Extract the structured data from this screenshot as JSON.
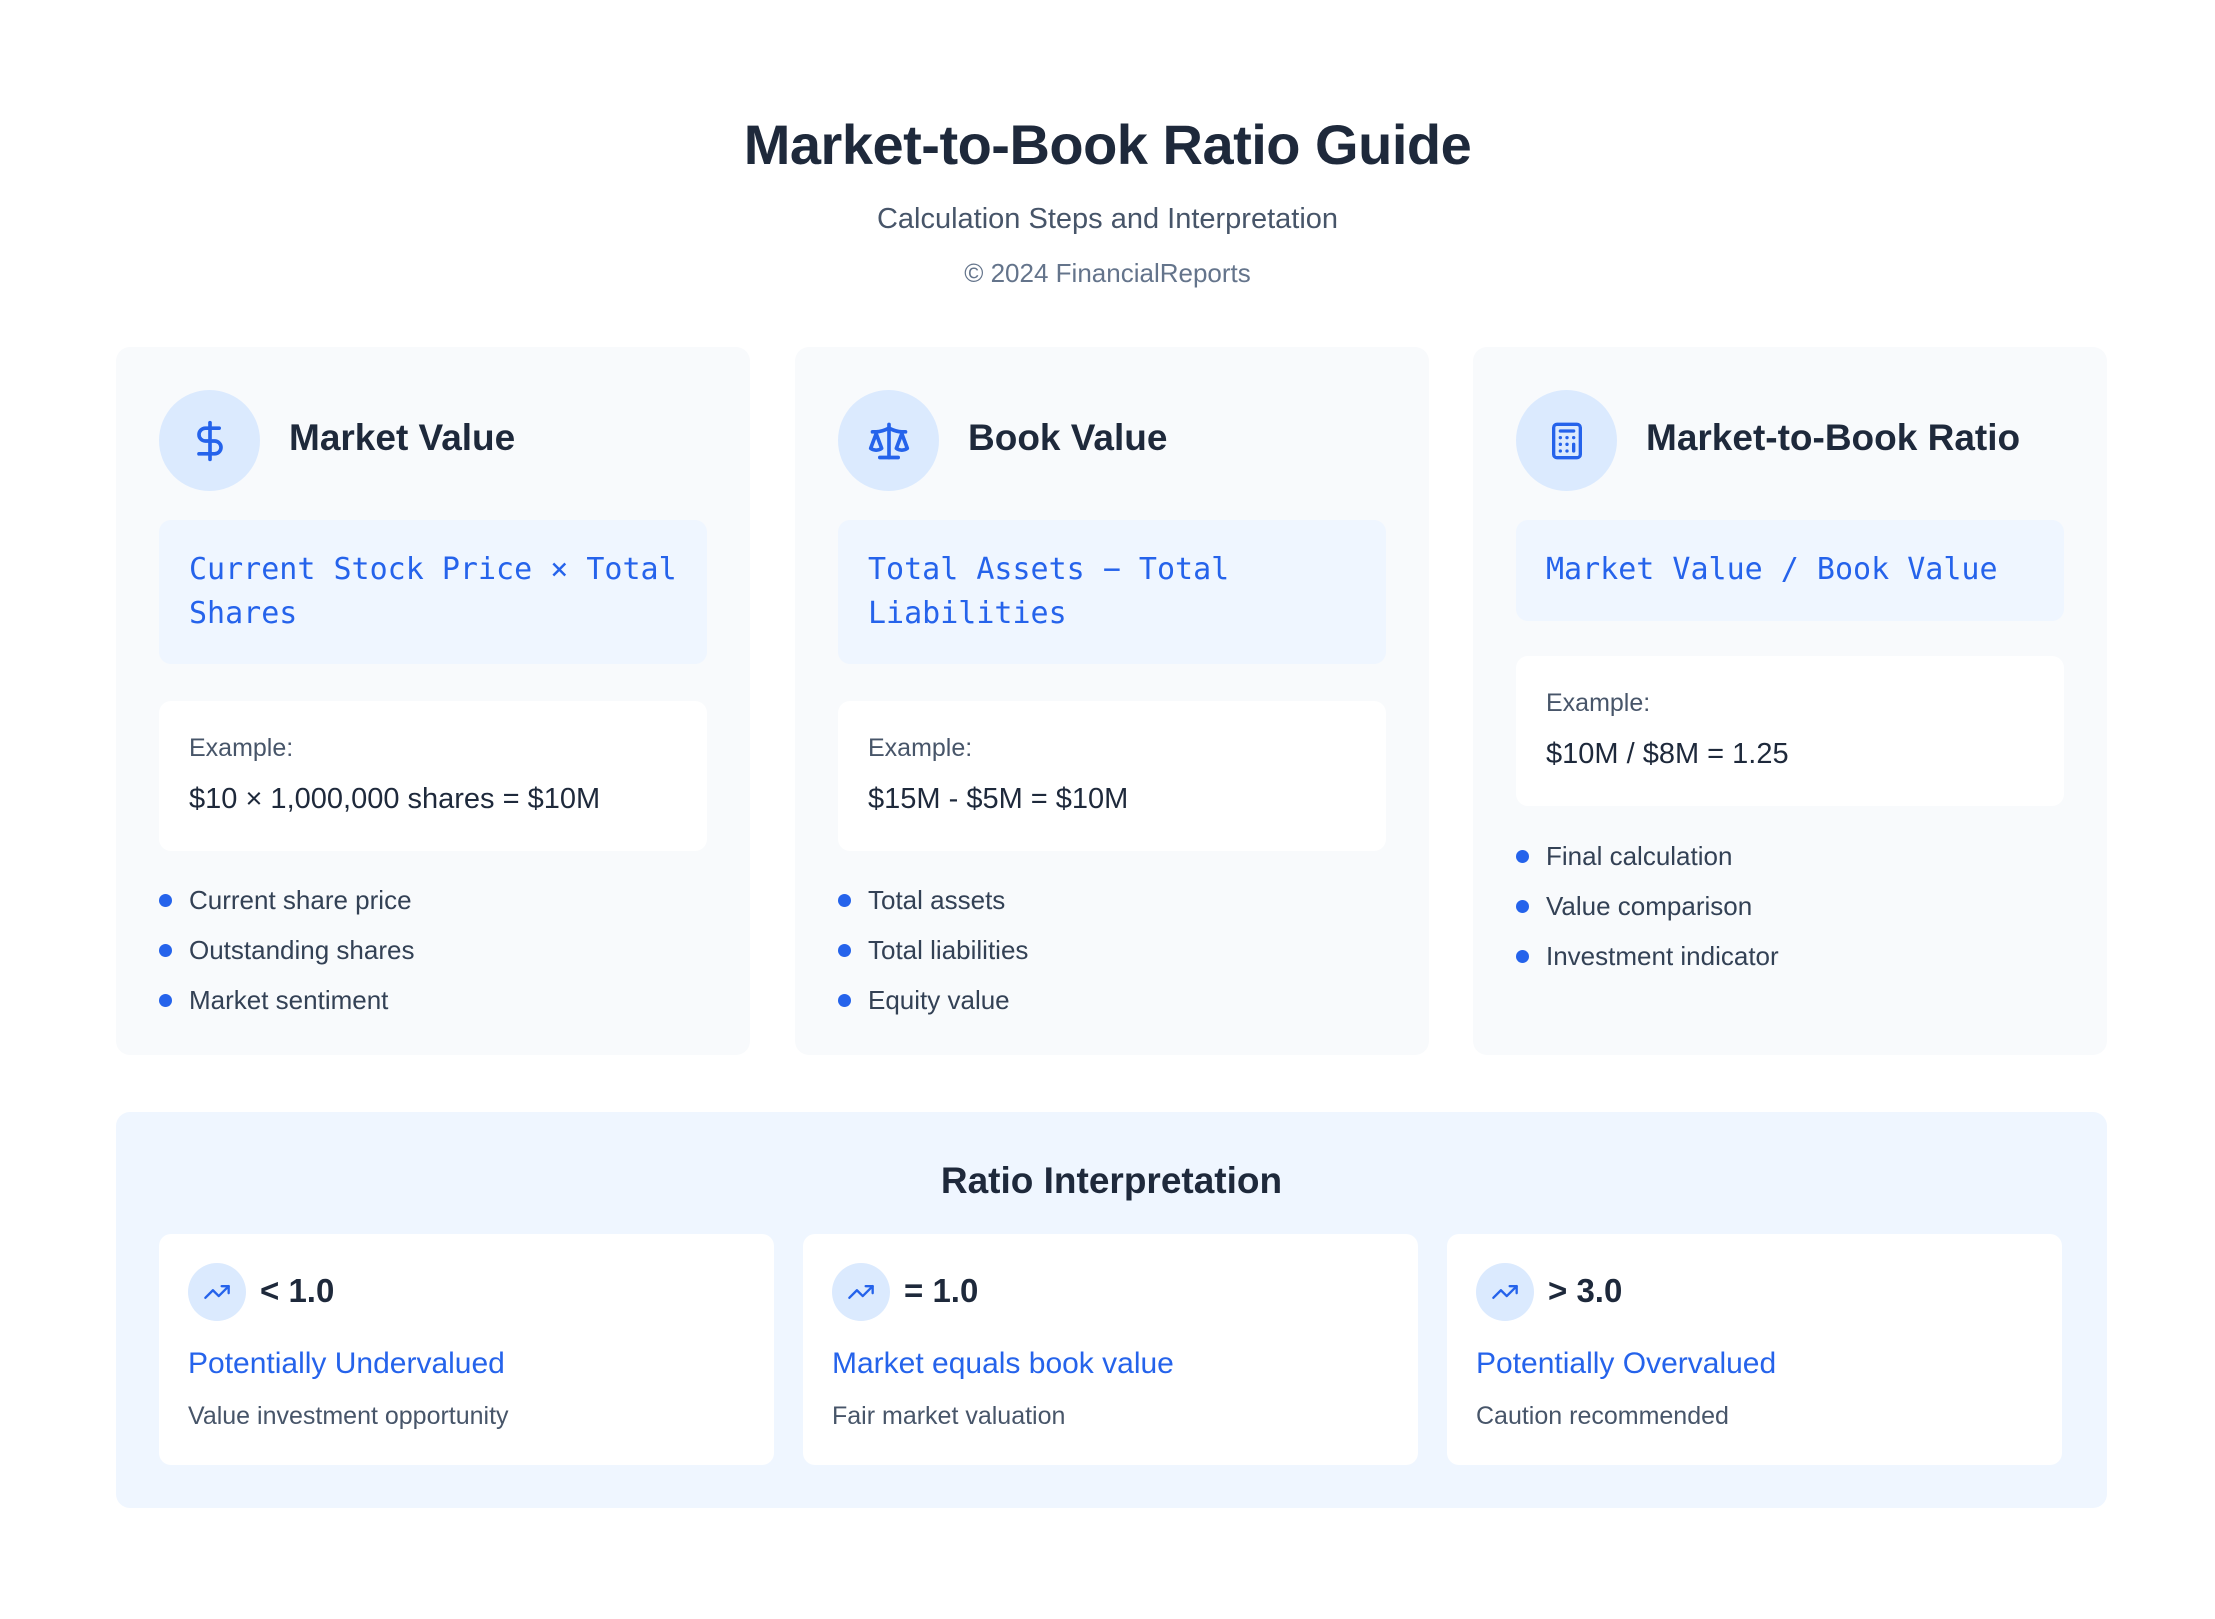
{
  "header": {
    "title": "Market-to-Book Ratio Guide",
    "subtitle": "Calculation Steps and Interpretation",
    "copyright": "© 2024 FinancialReports"
  },
  "cards": [
    {
      "icon": "dollar-icon",
      "title": "Market Value",
      "formula": "Current Stock Price × Total Shares",
      "example_label": "Example:",
      "example_value": "$10 × 1,000,000 shares = $10M",
      "bullets": [
        "Current share price",
        "Outstanding shares",
        "Market sentiment"
      ]
    },
    {
      "icon": "scale-icon",
      "title": "Book Value",
      "formula": "Total Assets − Total Liabilities",
      "example_label": "Example:",
      "example_value": "$15M - $5M = $10M",
      "bullets": [
        "Total assets",
        "Total liabilities",
        "Equity value"
      ]
    },
    {
      "icon": "calculator-icon",
      "title": "Market-to-Book Ratio",
      "formula": "Market Value / Book Value",
      "example_label": "Example:",
      "example_value": "$10M / $8M = 1.25",
      "bullets": [
        "Final calculation",
        "Value comparison",
        "Investment indicator"
      ]
    }
  ],
  "interpretation": {
    "title": "Ratio Interpretation",
    "items": [
      {
        "icon": "trending-up-icon",
        "range": "< 1.0",
        "verdict": "Potentially Undervalued",
        "description": "Value investment opportunity"
      },
      {
        "icon": "trending-up-icon",
        "range": "= 1.0",
        "verdict": "Market equals book value",
        "description": "Fair market valuation"
      },
      {
        "icon": "trending-up-icon",
        "range": "> 3.0",
        "verdict": "Potentially Overvalued",
        "description": "Caution recommended"
      }
    ]
  },
  "colors": {
    "accent": "#2563eb",
    "icon_bg": "#dbeafe",
    "card_bg": "#f8fafc",
    "panel_bg": "#eff6ff",
    "text": "#1e293b"
  }
}
